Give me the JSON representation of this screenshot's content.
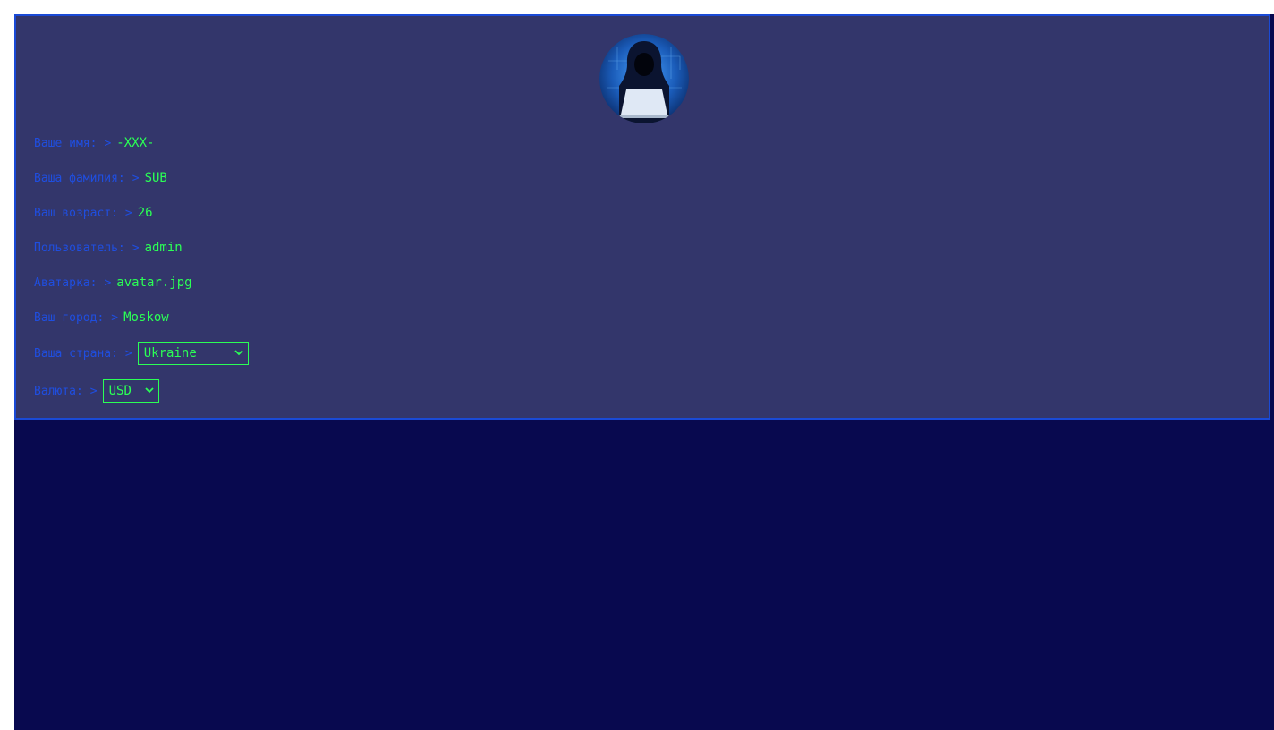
{
  "profile": {
    "fields": [
      {
        "label": "Ваше имя:",
        "arrow": ">",
        "value": "-XXX-"
      },
      {
        "label": "Ваша фамилия:",
        "arrow": ">",
        "value": "SUB"
      },
      {
        "label": "Ваш возраст:",
        "arrow": ">",
        "value": "26"
      },
      {
        "label": "Пользователь:",
        "arrow": ">",
        "value": "admin"
      },
      {
        "label": "Аватарка:",
        "arrow": ">",
        "value": "avatar.jpg"
      },
      {
        "label": "Ваш город:",
        "arrow": ">",
        "value": "Moskow"
      }
    ],
    "country": {
      "label": "Ваша страна:",
      "arrow": ">",
      "selected": "Ukraine"
    },
    "currency": {
      "label": "Валюта:",
      "arrow": ">",
      "selected": "USD"
    },
    "avatar_icon": "hooded-hacker-avatar"
  },
  "colors": {
    "page_background": "#08094f",
    "card_background": "#33366b",
    "card_border": "#1a4ad6",
    "label": "#1f4ee0",
    "value": "#2bff55"
  }
}
